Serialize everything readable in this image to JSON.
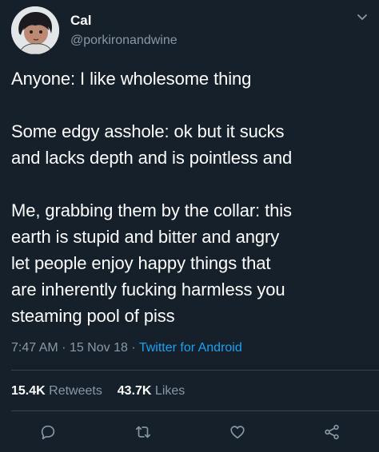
{
  "user": {
    "display_name": "Cal",
    "handle": "@porkironandwine"
  },
  "tweet": {
    "paragraphs": [
      [
        "Anyone: I like wholesome thing"
      ],
      [
        "Some edgy asshole: ok but it sucks",
        "and lacks depth and is pointless and"
      ],
      [
        "Me, grabbing them by the collar: this",
        "earth is stupid and bitter and angry",
        "let people enjoy happy things that",
        "are inherently fucking harmless you",
        "steaming pool of piss"
      ]
    ]
  },
  "meta": {
    "time": "7:47 AM",
    "separator": "·",
    "date": "15 Nov 18",
    "source": "Twitter for Android"
  },
  "stats": {
    "retweets_count": "15.4K",
    "retweets_label": "Retweets",
    "likes_count": "43.7K",
    "likes_label": "Likes"
  },
  "icons": {
    "reply": "reply-icon",
    "retweet": "retweet-icon",
    "like": "like-icon",
    "share": "share-icon",
    "menu": "chevron-down-icon"
  },
  "colors": {
    "background": "#15202b",
    "text": "#ffffff",
    "secondary": "#8899a6",
    "link": "#1da1f2",
    "divider": "#38444d"
  }
}
